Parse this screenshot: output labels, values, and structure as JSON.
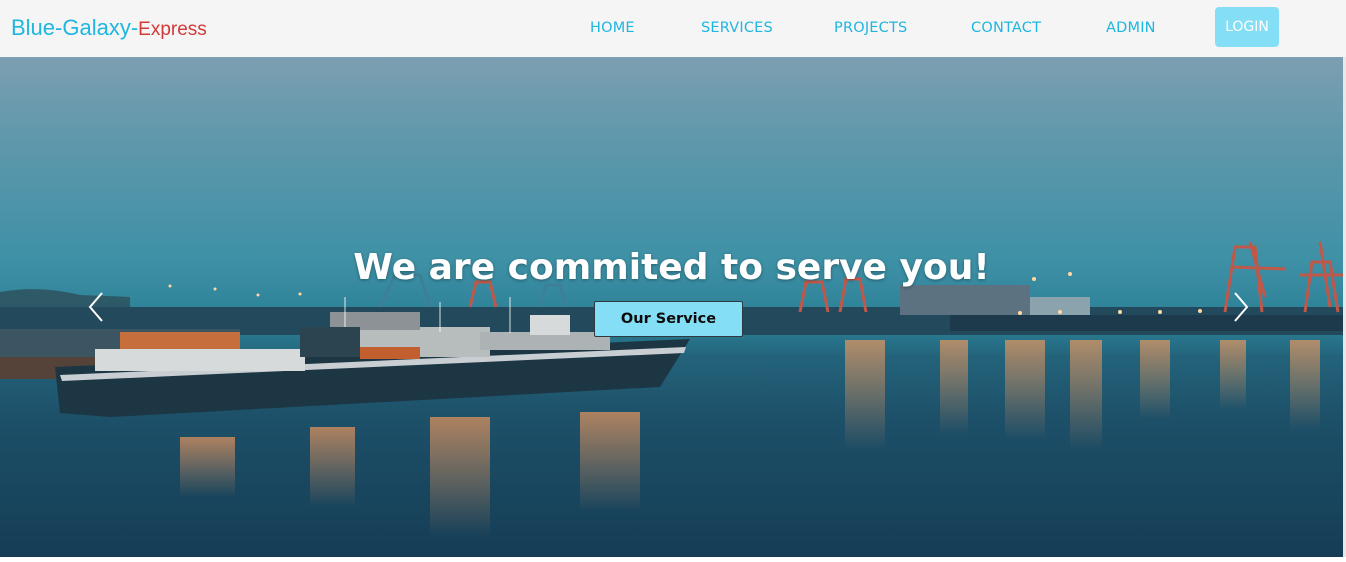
{
  "navbar": {
    "brand_main": "Blue-Galaxy",
    "brand_separator": "-",
    "brand_sub": "Express",
    "links": [
      "HOME",
      "SERVICES",
      "PROJECTS",
      "CONTACT",
      "ADMIN"
    ],
    "login_label": "LOGIN"
  },
  "hero": {
    "headline": "We are commited to serve you!",
    "cta_label": "Our Service",
    "prev_icon": "chevron-left-icon",
    "next_icon": "chevron-right-icon"
  },
  "colors": {
    "brand_blue": "#1fb6e0",
    "brand_red": "#d23a3a",
    "button_cyan": "#84def5",
    "navbar_bg": "#f5f5f5"
  }
}
